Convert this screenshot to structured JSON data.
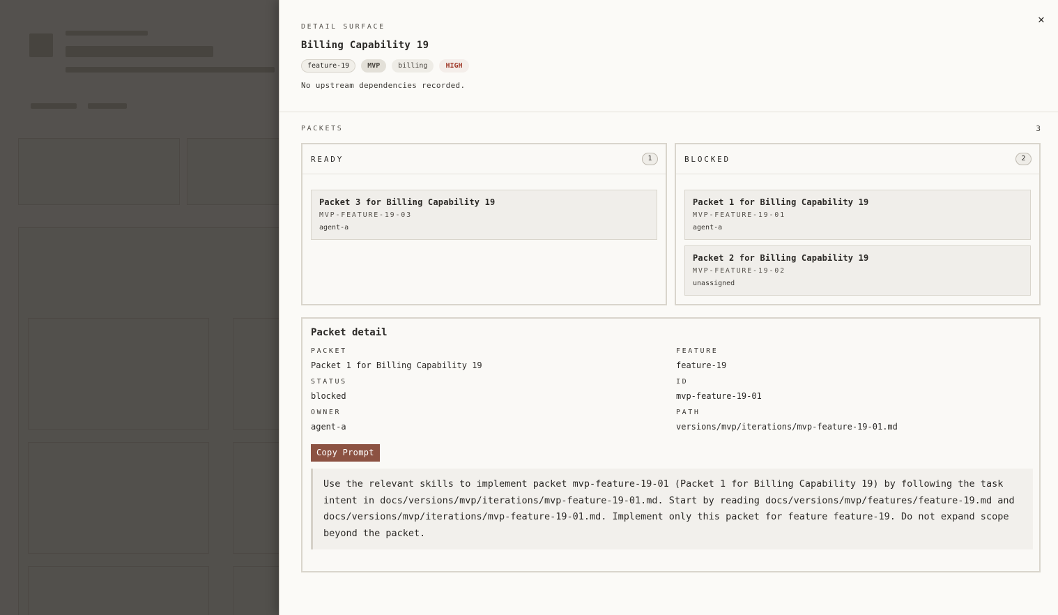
{
  "drawer": {
    "eyebrow": "DETAIL SURFACE",
    "title": "Billing Capability 19",
    "tags": [
      "feature-19",
      "MVP",
      "billing",
      "HIGH"
    ],
    "dependencies": "No upstream dependencies recorded.",
    "close_icon": "close-icon"
  },
  "packets": {
    "label": "PACKETS",
    "count": "3",
    "columns": [
      {
        "label": "READY",
        "count": "1",
        "items": [
          {
            "title": "Packet 3 for Billing Capability 19",
            "code": "MVP-FEATURE-19-03",
            "owner": "agent-a"
          }
        ]
      },
      {
        "label": "BLOCKED",
        "count": "2",
        "items": [
          {
            "title": "Packet 1 for Billing Capability 19",
            "code": "MVP-FEATURE-19-01",
            "owner": "agent-a"
          },
          {
            "title": "Packet 2 for Billing Capability 19",
            "code": "MVP-FEATURE-19-02",
            "owner": "unassigned"
          }
        ]
      }
    ]
  },
  "detail": {
    "heading": "Packet detail",
    "fields": {
      "packet": {
        "label": "PACKET",
        "value": "Packet 1 for Billing Capability 19"
      },
      "feature": {
        "label": "FEATURE",
        "value": "feature-19"
      },
      "status": {
        "label": "STATUS",
        "value": "blocked"
      },
      "id": {
        "label": "ID",
        "value": "mvp-feature-19-01"
      },
      "owner": {
        "label": "OWNER",
        "value": "agent-a"
      },
      "path": {
        "label": "PATH",
        "value": "versions/mvp/iterations/mvp-feature-19-01.md"
      }
    },
    "copy_label": "Copy Prompt",
    "prompt": "Use the relevant skills to implement packet mvp-feature-19-01 (Packet 1 for Billing Capability 19) by following the task intent in docs/versions/mvp/iterations/mvp-feature-19-01.md. Start by reading docs/versions/mvp/features/feature-19.md and docs/versions/mvp/iterations/mvp-feature-19-01.md. Implement only this packet for feature feature-19. Do not expand scope beyond the packet."
  }
}
